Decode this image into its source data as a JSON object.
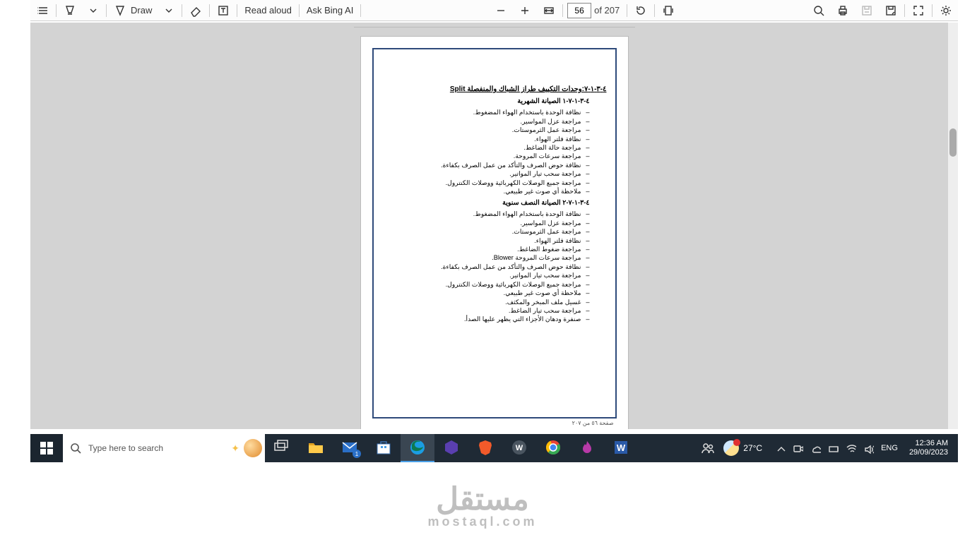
{
  "toolbar": {
    "draw_label": "Draw",
    "read_aloud_label": "Read aloud",
    "ask_ai_label": "Ask Bing AI",
    "page_value": "56",
    "page_of": "of 207"
  },
  "document": {
    "title": "٤-٣-١-٧:وحدات التكييف طراز الشباك والمنفصلة Split",
    "section1_heading": "٤-٣-١-٧-١ الصيانة الشهرية",
    "section1_items": [
      "نظافة الوحدة باستخدام الهواء المضغوط.",
      "مراجعة عزل المواسير.",
      "مراجعة عمل الثرموستات.",
      "نظافة فلتر الهواء.",
      "مراجعة حالة الضاغط.",
      "مراجعة سرعات المروحة.",
      "نظافة حوض الصرف والتأكد من عمل الصرف بكفاءة.",
      "مراجعة سحب تيار المواتير.",
      "مراجعة جميع الوصلات الكهربائية ووصلات الكنترول.",
      "ملاحظة أي صوت غير طبيعي."
    ],
    "section2_heading": "٤-٣-١-٧-٢ الصيانة النصف سنوية",
    "section2_items": [
      "نظافة الوحدة باستخدام الهواء المضغوط.",
      "مراجعة عزل المواسير.",
      "مراجعة عمل الثرموستات.",
      "نظافة فلتر الهواء.",
      "مراجعة ضغوط الضاغط.",
      "مراجعة سرعات المروحة Blower.",
      "نظافة حوض الصرف والتأكد من عمل الصرف بكفاءة.",
      "مراجعة سحب تيار المواتير.",
      "مراجعة جميع الوصلات الكهربائية ووصلات الكنترول.",
      "ملاحظة أي صوت غير طبيعي.",
      "غسيل ملف المبخر والمكثف.",
      "مراجعة سحب تيار الضاغط.",
      "صنفرة ودهان الأجزاء التي يظهر عليها الصدأ."
    ],
    "footer": "صفحة ٥٦ من ٢٠٧"
  },
  "taskbar": {
    "search_placeholder": "Type here to search",
    "weather_temp": "27°C",
    "lang": "ENG",
    "time": "12:36 AM",
    "date": "29/09/2023",
    "mail_badge": "1"
  },
  "brand": {
    "name_ar": "مستقل",
    "url": "mostaql.com"
  }
}
